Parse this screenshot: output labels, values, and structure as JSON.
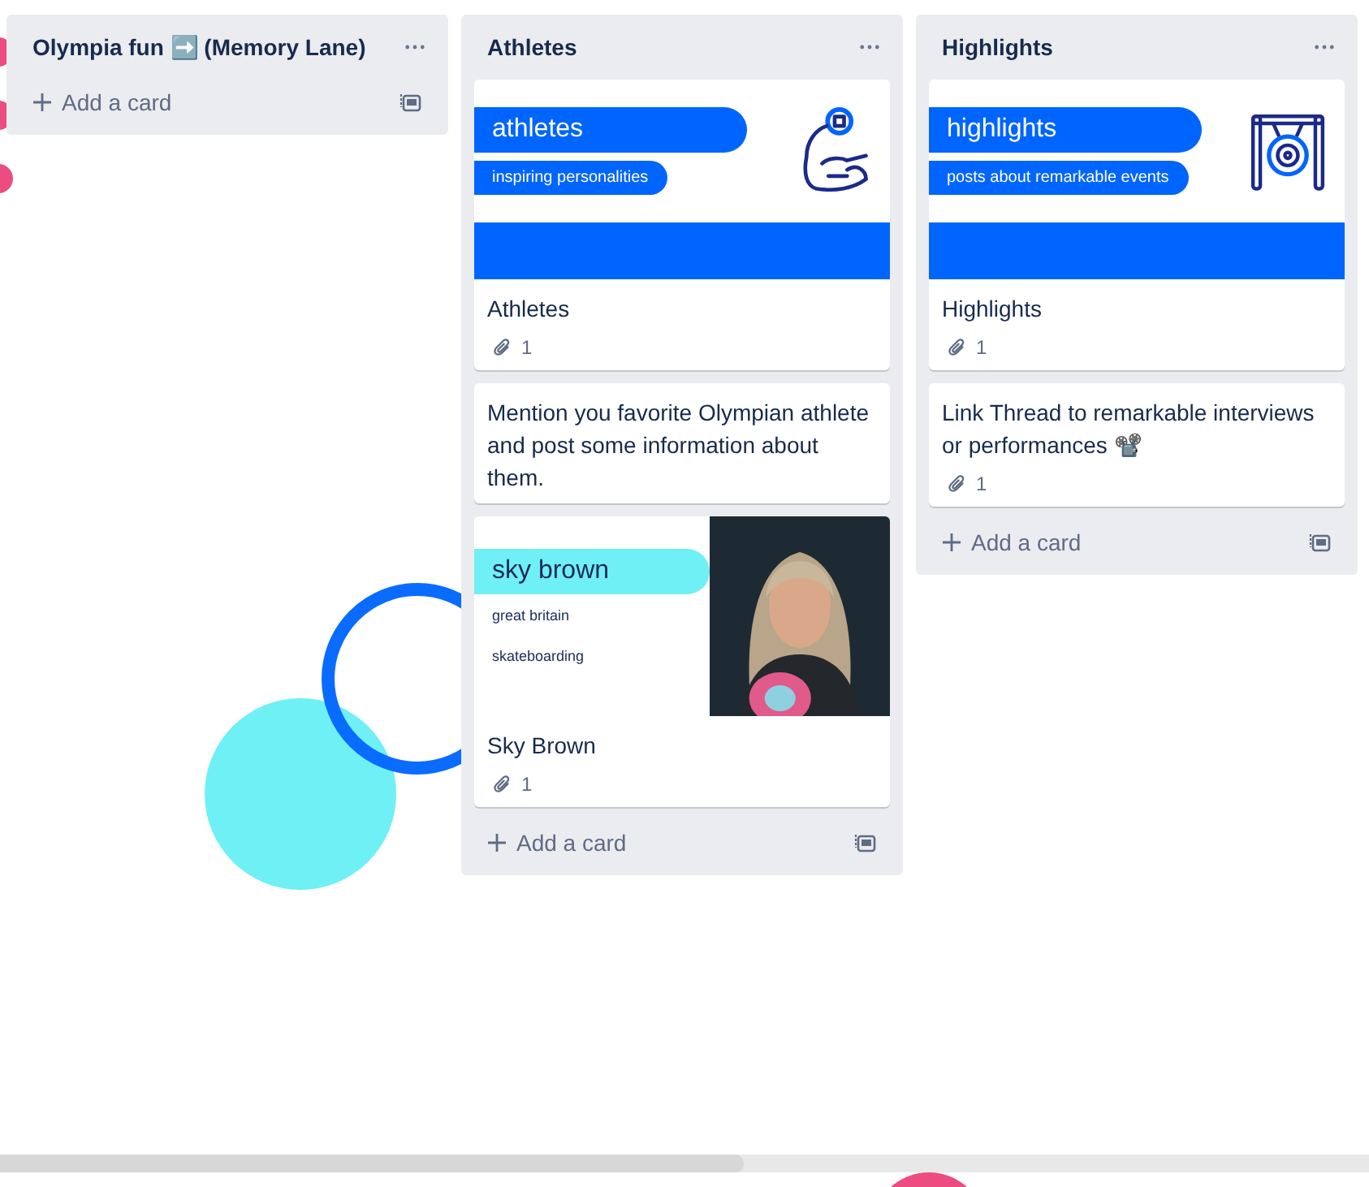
{
  "lists": [
    {
      "title": "Olympia fun ➡️ (Memory Lane)",
      "add_label": "Add a card"
    },
    {
      "title": "Athletes",
      "cards": [
        {
          "kind": "cover",
          "cover": {
            "title": "athletes",
            "subtitle": "inspiring personalities"
          },
          "title": "Athletes",
          "attachments": "1"
        },
        {
          "kind": "text",
          "title": "Mention you favorite Olympian athlete and post some information about them."
        },
        {
          "kind": "profile",
          "cover": {
            "title": "sky brown",
            "lines": [
              "great britain",
              "skateboarding"
            ]
          },
          "title": "Sky Brown",
          "attachments": "1"
        }
      ],
      "add_label": "Add a card"
    },
    {
      "title": "Highlights",
      "cards": [
        {
          "kind": "cover",
          "cover": {
            "title": "highlights",
            "subtitle": "posts about remarkable events"
          },
          "title": "Highlights",
          "attachments": "1"
        },
        {
          "kind": "text",
          "title": "Link Thread to remarkable interviews or performances 📽️",
          "attachments": "1"
        }
      ],
      "add_label": "Add a card"
    }
  ]
}
